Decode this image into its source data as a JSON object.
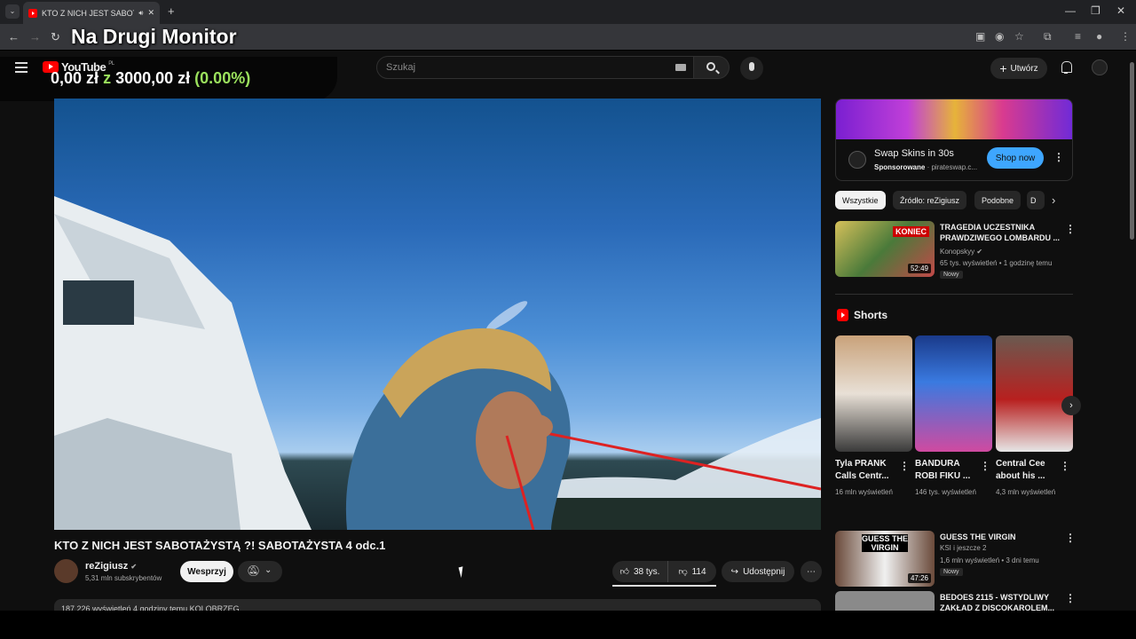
{
  "browser": {
    "tab_title": "KTO Z NICH JEST SABOTAŹ",
    "window_controls": [
      "—",
      "❐",
      "✕"
    ]
  },
  "overlay": {
    "title": "Na Drugi Monitor",
    "money_value": "0,00 zł",
    "money_sep": "z",
    "money_goal": "3000,00 zł",
    "money_pct": "(0.00%)"
  },
  "header": {
    "logo_text": "YouTube",
    "logo_region": "PL",
    "search_placeholder": "Szukaj",
    "create_label": "Utwórz"
  },
  "video": {
    "title": "KTO Z NICH JEST SABOTAŻYSTĄ ?! SABOTAŻYSTA 4 odc.1",
    "channel": "reZigiusz",
    "subscribers": "5,31 mln subskrybentów",
    "support_label": "Wesprzyj",
    "likes": "38 tys.",
    "dislikes": "114",
    "share_label": "Udostępnij",
    "desc_line": "187 226 wyświetleń  4 godziny temu  KOLOBRZEG"
  },
  "ad": {
    "title": "Swap Skins in 30s",
    "sponsored": "Sponsorowane",
    "domain": "· pirateswap.c...",
    "cta": "Shop now"
  },
  "chips": [
    "Wszystkie",
    "Źródło: reZigiusz",
    "Podobne",
    "D"
  ],
  "recommended": [
    {
      "title": "TRAGEDIA UCZESTNIKA PRAWDZIWEGO LOMBARDU ...",
      "channel": "Konopskyy",
      "meta": "65 tys. wyświetleń • 1 godzinę temu",
      "badge": "Nowy",
      "duration": "52:49",
      "thumb_text": "KONIEC"
    },
    {
      "title": "GUESS THE VIRGIN",
      "channel": "KSI i jeszcze 2",
      "meta": "1,6 mln wyświetleń • 3 dni temu",
      "badge": "Nowy",
      "duration": "47:26",
      "thumb_text": "GUESS THE VIRGIN"
    },
    {
      "title": "BEDOES 2115 - WSTYDLIWY ZAKŁAD Z DISCOKAROLEM..."
    }
  ],
  "shorts": {
    "label": "Shorts",
    "items": [
      {
        "title": "Tyla PRANK Calls Centr...",
        "views": "16 mln wyświetleń"
      },
      {
        "title": "BANDURA ROBI FIKU ...",
        "views": "146 tys. wyświetleń"
      },
      {
        "title": "Central Cee about his ...",
        "views": "4,3 mln wyświetleń"
      }
    ]
  }
}
